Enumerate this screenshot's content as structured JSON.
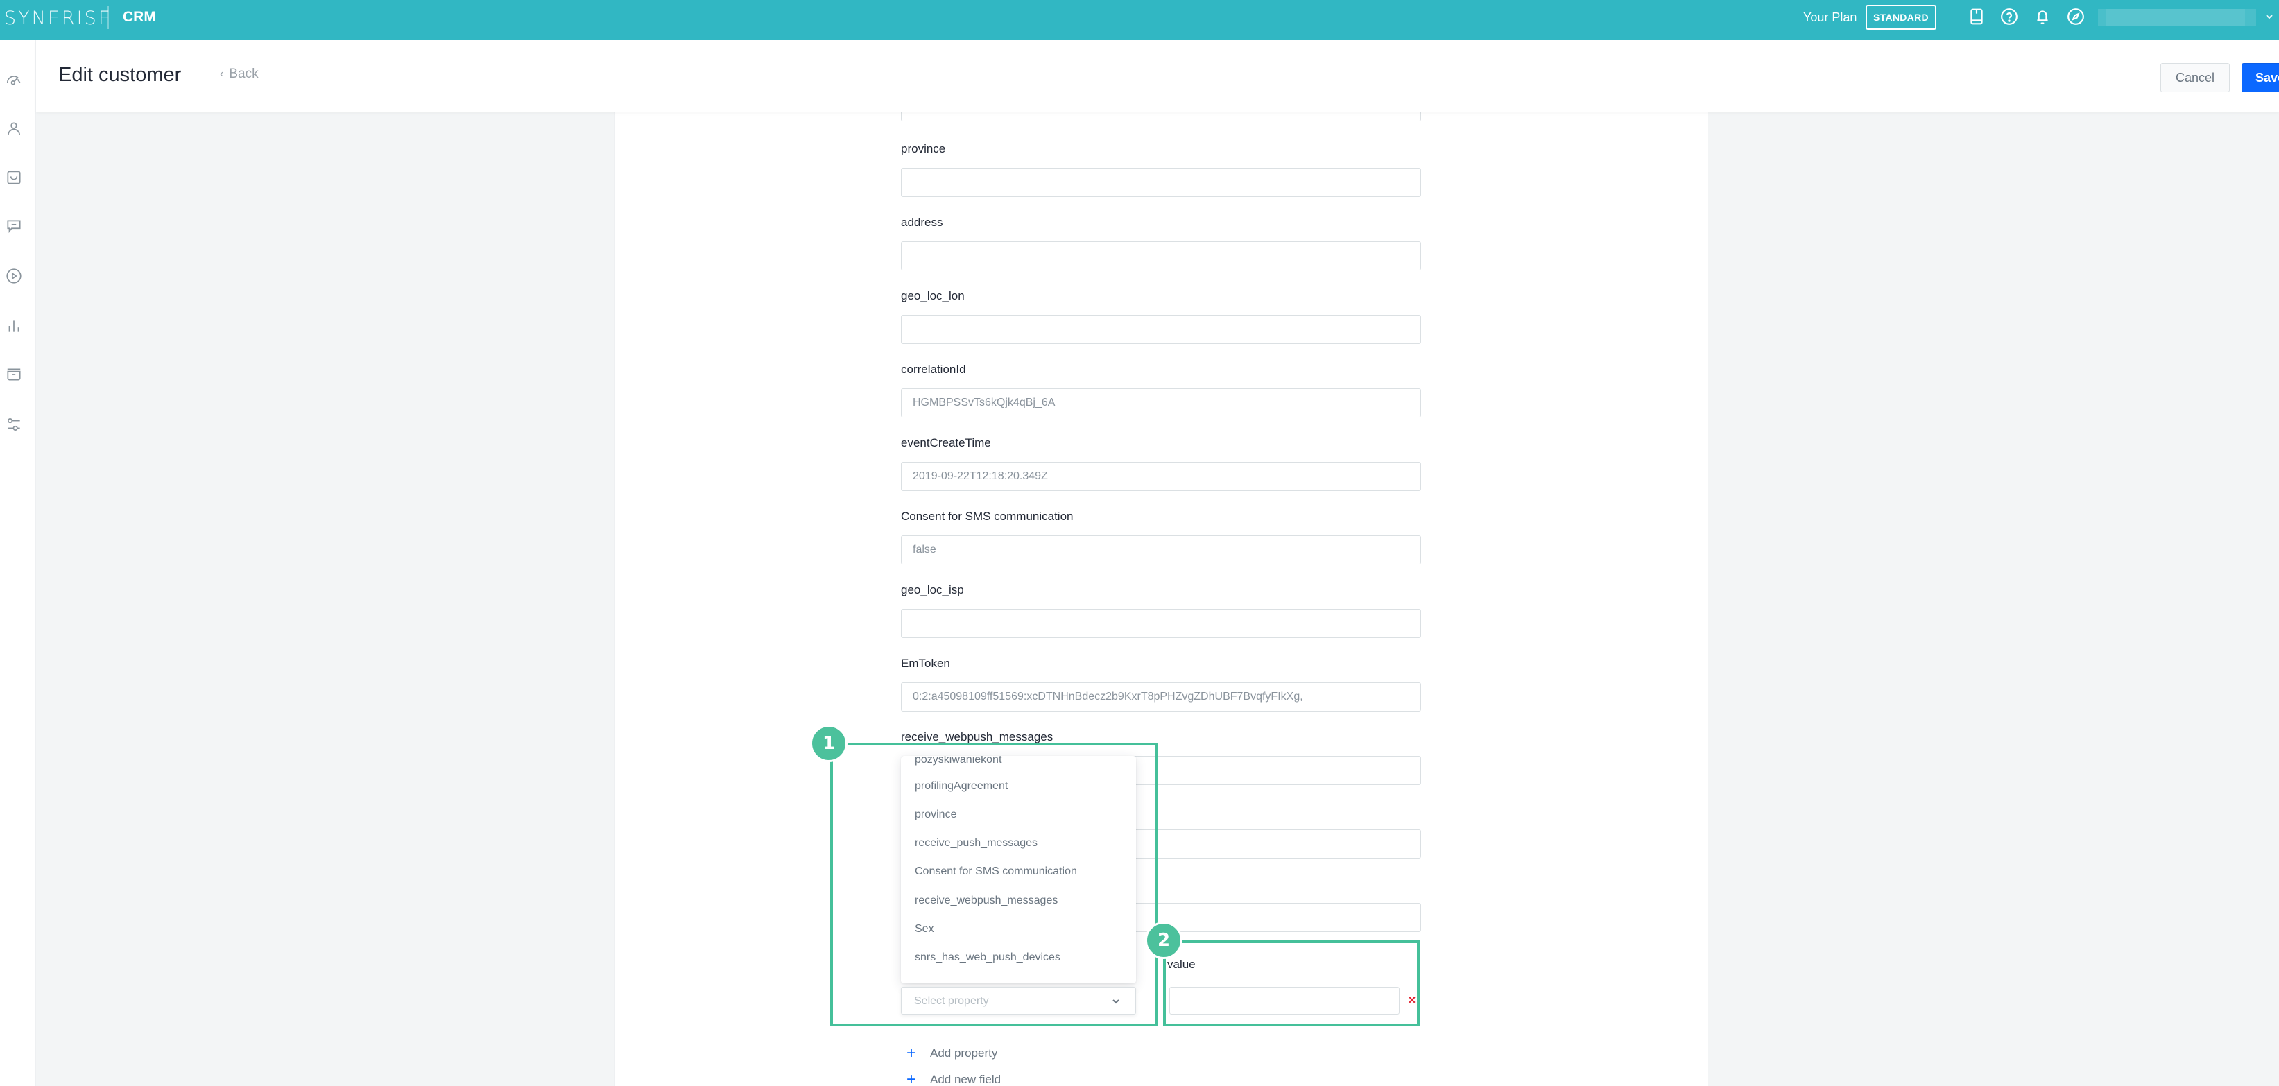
{
  "topbar": {
    "logo": "SYNERISE",
    "app_name": "CRM",
    "plan_label": "Your Plan",
    "plan_badge": "STANDARD",
    "icons": [
      "book-icon",
      "help-icon",
      "bell-icon",
      "compass-icon"
    ],
    "user_menu_chevron": "chevron-down-icon",
    "accent_color": "#31b7c3"
  },
  "sidebar": {
    "items": [
      {
        "icon": "dashboard-gauge-icon"
      },
      {
        "icon": "user-icon"
      },
      {
        "icon": "inbox-icon"
      },
      {
        "icon": "chat-icon"
      },
      {
        "icon": "play-icon"
      },
      {
        "icon": "analytics-bars-icon"
      },
      {
        "icon": "catalog-box-icon"
      },
      {
        "icon": "settings-sliders-icon"
      }
    ]
  },
  "header": {
    "title": "Edit customer",
    "back_label": "Back",
    "cancel_label": "Cancel",
    "save_label": "Save",
    "save_color": "#0b68ff"
  },
  "form": {
    "fields": [
      {
        "label": "province",
        "value": ""
      },
      {
        "label": "address",
        "value": ""
      },
      {
        "label": "geo_loc_lon",
        "value": ""
      },
      {
        "label": "correlationId",
        "value": "HGMBPSSvTs6kQjk4qBj_6A"
      },
      {
        "label": "eventCreateTime",
        "value": "2019-09-22T12:18:20.349Z"
      },
      {
        "label": "Consent for SMS communication",
        "value": "false"
      },
      {
        "label": "geo_loc_isp",
        "value": ""
      },
      {
        "label": "EmToken",
        "value": "0:2:a45098109ff51569:xcDTNHnBdecz2b9KxrT8pPHZvgZDhUBF7BvqfyFIkXg,"
      },
      {
        "label": "receive_webpush_messages",
        "value": ""
      }
    ],
    "hidden_inputs_count": 2,
    "property_select": {
      "placeholder": "Select property",
      "options": [
        "pozyskiwaniekont",
        "profilingAgreement",
        "province",
        "receive_push_messages",
        "Consent for SMS communication",
        "receive_webpush_messages",
        "Sex",
        "snrs_has_web_push_devices"
      ]
    },
    "value_label": "value",
    "value_input": "",
    "remove_label": "×",
    "add_property_label": "Add property",
    "add_field_label": "Add new field"
  },
  "annotations": [
    {
      "number": "1",
      "color": "#45c09a"
    },
    {
      "number": "2",
      "color": "#45c09a"
    }
  ]
}
